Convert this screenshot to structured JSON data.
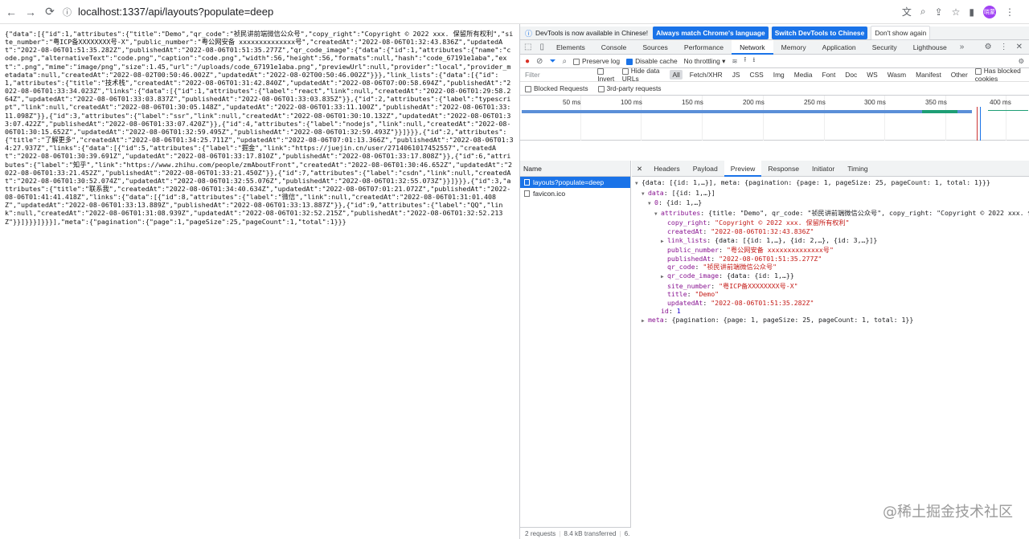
{
  "browser": {
    "url": "localhost:1337/api/layouts?populate=deep",
    "avatar_text": "晓蒙"
  },
  "raw_json": "{\"data\":[{\"id\":1,\"attributes\":{\"title\":\"Demo\",\"qr_code\":\"祯民讲前端微信公众号\",\"copy_right\":\"Copyright © 2022 xxx. 保留所有权利\",\"site_number\":\"粤ICP备XXXXXXXX号-X\",\"public_number\":\"粤公网安备 xxxxxxxxxxxxxx号\",\"createdAt\":\"2022-08-06T01:32:43.836Z\",\"updatedAt\":\"2022-08-06T01:51:35.282Z\",\"publishedAt\":\"2022-08-06T01:51:35.277Z\",\"qr_code_image\":{\"data\":{\"id\":1,\"attributes\":{\"name\":\"code.png\",\"alternativeText\":\"code.png\",\"caption\":\"code.png\",\"width\":56,\"height\":56,\"formats\":null,\"hash\":\"code_67191e1aba\",\"ext\":\".png\",\"mime\":\"image/png\",\"size\":1.45,\"url\":\"/uploads/code_67191e1aba.png\",\"previewUrl\":null,\"provider\":\"local\",\"provider_metadata\":null,\"createdAt\":\"2022-08-02T00:50:46.002Z\",\"updatedAt\":\"2022-08-02T00:50:46.002Z\"}}},\"link_lists\":{\"data\":[{\"id\":1,\"attributes\":{\"title\":\"技术栈\",\"createdAt\":\"2022-08-06T01:31:42.840Z\",\"updatedAt\":\"2022-08-06T07:00:58.694Z\",\"publishedAt\":\"2022-08-06T01:33:34.023Z\",\"links\":{\"data\":[{\"id\":1,\"attributes\":{\"label\":\"react\",\"link\":null,\"createdAt\":\"2022-08-06T01:29:58.264Z\",\"updatedAt\":\"2022-08-06T01:33:03.837Z\",\"publishedAt\":\"2022-08-06T01:33:03.835Z\"}},{\"id\":2,\"attributes\":{\"label\":\"typescript\",\"link\":null,\"createdAt\":\"2022-08-06T01:30:05.148Z\",\"updatedAt\":\"2022-08-06T01:33:11.100Z\",\"publishedAt\":\"2022-08-06T01:33:11.098Z\"}},{\"id\":3,\"attributes\":{\"label\":\"ssr\",\"link\":null,\"createdAt\":\"2022-08-06T01:30:10.132Z\",\"updatedAt\":\"2022-08-06T01:33:07.422Z\",\"publishedAt\":\"2022-08-06T01:33:07.420Z\"}},{\"id\":4,\"attributes\":{\"label\":\"nodejs\",\"link\":null,\"createdAt\":\"2022-08-06T01:30:15.652Z\",\"updatedAt\":\"2022-08-06T01:32:59.495Z\",\"publishedAt\":\"2022-08-06T01:32:59.493Z\"}}]}}},{\"id\":2,\"attributes\":{\"title\":\"了解更多\",\"createdAt\":\"2022-08-06T01:34:25.711Z\",\"updatedAt\":\"2022-08-06T07:01:13.366Z\",\"publishedAt\":\"2022-08-06T01:34:27.937Z\",\"links\":{\"data\":[{\"id\":5,\"attributes\":{\"label\":\"掘金\",\"link\":\"https://juejin.cn/user/2714061017452557\",\"createdAt\":\"2022-08-06T01:30:39.691Z\",\"updatedAt\":\"2022-08-06T01:33:17.810Z\",\"publishedAt\":\"2022-08-06T01:33:17.808Z\"}},{\"id\":6,\"attributes\":{\"label\":\"知乎\",\"link\":\"https://www.zhihu.com/people/zmAboutFront\",\"createdAt\":\"2022-08-06T01:30:46.652Z\",\"updatedAt\":\"2022-08-06T01:33:21.452Z\",\"publishedAt\":\"2022-08-06T01:33:21.450Z\"}},{\"id\":7,\"attributes\":{\"label\":\"csdn\",\"link\":null,\"createdAt\":\"2022-08-06T01:30:52.074Z\",\"updatedAt\":\"2022-08-06T01:32:55.076Z\",\"publishedAt\":\"2022-08-06T01:32:55.073Z\"}}]}}},{\"id\":3,\"attributes\":{\"title\":\"联系我\",\"createdAt\":\"2022-08-06T01:34:40.634Z\",\"updatedAt\":\"2022-08-06T07:01:21.072Z\",\"publishedAt\":\"2022-08-06T01:41:41.418Z\",\"links\":{\"data\":[{\"id\":8,\"attributes\":{\"label\":\"微信\",\"link\":null,\"createdAt\":\"2022-08-06T01:31:01.408Z\",\"updatedAt\":\"2022-08-06T01:33:13.889Z\",\"publishedAt\":\"2022-08-06T01:33:13.887Z\"}},{\"id\":9,\"attributes\":{\"label\":\"QQ\",\"link\":null,\"createdAt\":\"2022-08-06T01:31:08.939Z\",\"updatedAt\":\"2022-08-06T01:32:52.215Z\",\"publishedAt\":\"2022-08-06T01:32:52.213Z\"}}]}}}]}}}],\"meta\":{\"pagination\":{\"page\":1,\"pageSize\":25,\"pageCount\":1,\"total\":1}}}",
  "devtools": {
    "info_text": "DevTools is now available in Chinese!",
    "btn_match": "Always match Chrome's language",
    "btn_switch": "Switch DevTools to Chinese",
    "btn_dont": "Don't show again",
    "tabs": [
      "Elements",
      "Console",
      "Sources",
      "Performance",
      "Network",
      "Memory",
      "Application",
      "Security",
      "Lighthouse"
    ],
    "preserve_log": "Preserve log",
    "disable_cache": "Disable cache",
    "throttling": "No throttling",
    "filter_placeholder": "Filter",
    "invert": "Invert",
    "hide_data_urls": "Hide data URLs",
    "filter_types": [
      "All",
      "Fetch/XHR",
      "JS",
      "CSS",
      "Img",
      "Media",
      "Font",
      "Doc",
      "WS",
      "Wasm",
      "Manifest",
      "Other"
    ],
    "has_blocked_cookies": "Has blocked cookies",
    "blocked_requests": "Blocked Requests",
    "third_party": "3rd-party requests",
    "timeline_ticks": [
      "50 ms",
      "100 ms",
      "150 ms",
      "200 ms",
      "250 ms",
      "300 ms",
      "350 ms",
      "400 ms"
    ],
    "name_header": "Name",
    "requests": [
      "layouts?populate=deep",
      "favicon.ico"
    ],
    "status_requests": "2 requests",
    "status_transferred": "8.4 kB transferred",
    "status_more": "6.",
    "detail_tabs": [
      "Headers",
      "Payload",
      "Preview",
      "Response",
      "Initiator",
      "Timing"
    ]
  },
  "preview": {
    "root": "{data: [{id: 1,…}], meta: {pagination: {page: 1, pageSize: 25, pageCount: 1, total: 1}}}",
    "data_key": "data",
    "data_summary": "[{id: 1,…}]",
    "item_key": "0",
    "item_summary": "{id: 1,…}",
    "attributes_key": "attributes",
    "attributes_summary": "{title: \"Demo\", qr_code: \"祯民讲前端微信公众号\", copy_right: \"Copyright © 2022 xxx. 保留所有权利\"",
    "copy_right": "\"Copyright © 2022 xxx. 保留所有权利\"",
    "createdAt": "\"2022-08-06T01:32:43.836Z\"",
    "link_lists": "{data: [{id: 1,…}, {id: 2,…}, {id: 3,…}]}",
    "public_number": "\"粤公网安备 xxxxxxxxxxxxxx号\"",
    "publishedAt": "\"2022-08-06T01:51:35.277Z\"",
    "qr_code": "\"祯民讲前端微信公众号\"",
    "qr_code_image": "{data: {id: 1,…}}",
    "site_number": "\"粤ICP备XXXXXXXX号-X\"",
    "title": "\"Demo\"",
    "updatedAt": "\"2022-08-06T01:51:35.282Z\"",
    "id": "1",
    "meta_key": "meta",
    "meta_summary": "{pagination: {page: 1, pageSize: 25, pageCount: 1, total: 1}}"
  },
  "watermark": "@稀土掘金技术社区"
}
